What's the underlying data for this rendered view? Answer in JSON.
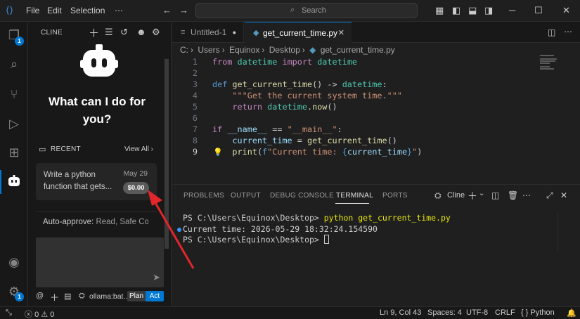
{
  "titlebar": {
    "menu": [
      "File",
      "Edit",
      "Selection",
      "⋯"
    ],
    "search_placeholder": "Search"
  },
  "activity": {
    "explorer_badge": "1",
    "settings_badge": "1"
  },
  "sidebar": {
    "title": "CLINE",
    "welcome": "What can I do for you?",
    "recent_label": "RECENT",
    "view_all": "View All",
    "task": {
      "text": "Write a python function that gets...",
      "date": "May 29",
      "cost": "$0.00"
    },
    "auto_approve": {
      "label": "Auto-approve:",
      "value": "Read, Safe Co..."
    },
    "model": "ollama:bat...",
    "plan_label": "Plan",
    "act_label": "Act"
  },
  "tabs": [
    {
      "label": "Untitled-1"
    },
    {
      "label": "get_current_time.py"
    }
  ],
  "breadcrumb": [
    "C:",
    "Users",
    "Equinox",
    "Desktop",
    "get_current_time.py"
  ],
  "code": {
    "line_numbers": [
      "1",
      "2",
      "3",
      "4",
      "5",
      "6",
      "7",
      "8",
      "9"
    ],
    "lines": [
      "from datetime import datetime",
      "",
      "def get_current_time() -> datetime:",
      "    \"\"\"Get the current system time.\"\"\"",
      "    return datetime.now()",
      "",
      "if __name__ == \"__main__\":",
      "    current_time = get_current_time()",
      "    print(f\"Current time: {current_time}\")"
    ]
  },
  "panel": {
    "tabs": [
      "PROBLEMS",
      "OUTPUT",
      "DEBUG CONSOLE",
      "TERMINAL",
      "PORTS"
    ],
    "active_tab": "TERMINAL",
    "terminal_name": "Cline",
    "terminal": {
      "line1_prompt": "PS C:\\Users\\Equinox\\Desktop> ",
      "line1_cmd": "python get_current_time.py",
      "line2": "Current time: 2026-05-29 18:32:24.154590",
      "line3_prompt": "PS C:\\Users\\Equinox\\Desktop> "
    }
  },
  "statusbar": {
    "errors": "0",
    "warnings": "0",
    "position": "Ln 9, Col 43",
    "spaces": "Spaces: 4",
    "encoding": "UTF-8",
    "eol": "CRLF",
    "language": "Python"
  },
  "colors": {
    "accent": "#0078d4",
    "annotation_arrow": "#e2262b"
  }
}
